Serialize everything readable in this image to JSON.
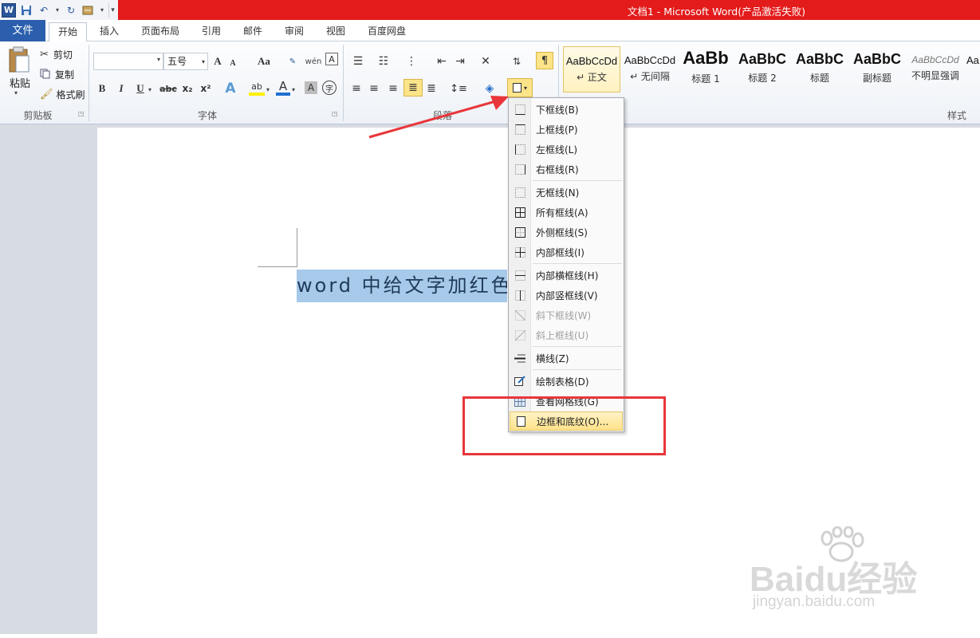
{
  "window": {
    "title": "文档1 - Microsoft Word(产品激活失败)"
  },
  "quick_access": {
    "word_logo": "W"
  },
  "tabs": [
    "文件",
    "开始",
    "插入",
    "页面布局",
    "引用",
    "邮件",
    "审阅",
    "视图",
    "百度网盘"
  ],
  "clipboard": {
    "paste": "粘贴",
    "cut": "剪切",
    "copy": "复制",
    "format_painter": "格式刷",
    "group": "剪贴板"
  },
  "font": {
    "font_name": "",
    "font_size": "五号",
    "group": "字体",
    "grow": "A",
    "shrink": "A",
    "case": "Aa",
    "bold": "B",
    "italic": "I",
    "underline": "U",
    "strike": "abc",
    "sub": "x₂",
    "sup": "x²",
    "effects": "A",
    "highlight": "ab",
    "color": "A",
    "shade": "A",
    "enclose": "字"
  },
  "paragraph": {
    "group": "段落"
  },
  "styles": {
    "group": "样式",
    "items": [
      {
        "sample": "AaBbCcDd",
        "name": "↵ 正文"
      },
      {
        "sample": "AaBbCcDd",
        "name": "↵ 无间隔"
      },
      {
        "sample": "AaBb",
        "name": "标题 1"
      },
      {
        "sample": "AaBbC",
        "name": "标题 2"
      },
      {
        "sample": "AaBbC",
        "name": "标题"
      },
      {
        "sample": "AaBbC",
        "name": "副标题"
      },
      {
        "sample": "AaBbCcDd",
        "name": "不明显强调"
      },
      {
        "sample": "Aa",
        "name": ""
      }
    ]
  },
  "document": {
    "selected_text": "word 中给文字加红色边框"
  },
  "border_menu": {
    "items": [
      {
        "label": "下框线(B)",
        "icon": "bottom-border-icon"
      },
      {
        "label": "上框线(P)",
        "icon": "top-border-icon"
      },
      {
        "label": "左框线(L)",
        "icon": "left-border-icon"
      },
      {
        "label": "右框线(R)",
        "icon": "right-border-icon"
      },
      {
        "label": "无框线(N)",
        "icon": "no-border-icon"
      },
      {
        "label": "所有框线(A)",
        "icon": "all-borders-icon"
      },
      {
        "label": "外侧框线(S)",
        "icon": "outside-borders-icon"
      },
      {
        "label": "内部框线(I)",
        "icon": "inside-borders-icon"
      },
      {
        "label": "内部横框线(H)",
        "icon": "inside-horizontal-border-icon"
      },
      {
        "label": "内部竖框线(V)",
        "icon": "inside-vertical-border-icon"
      },
      {
        "label": "斜下框线(W)",
        "icon": "diagonal-down-border-icon"
      },
      {
        "label": "斜上框线(U)",
        "icon": "diagonal-up-border-icon"
      },
      {
        "label": "横线(Z)",
        "icon": "horizontal-line-icon"
      },
      {
        "label": "绘制表格(D)",
        "icon": "draw-table-icon"
      },
      {
        "label": "查看网格线(G)",
        "icon": "view-gridlines-icon"
      },
      {
        "label": "边框和底纹(O)...",
        "icon": "borders-shading-icon"
      }
    ]
  },
  "watermark": {
    "brand": "Baidu经验",
    "url": "jingyan.baidu.com"
  },
  "colors": {
    "title_bar": "#e31b1b",
    "file_tab": "#2b5fad",
    "selection": "#a7c9ea",
    "annotation": "#e8363a",
    "highlight": "#ffe28a"
  }
}
